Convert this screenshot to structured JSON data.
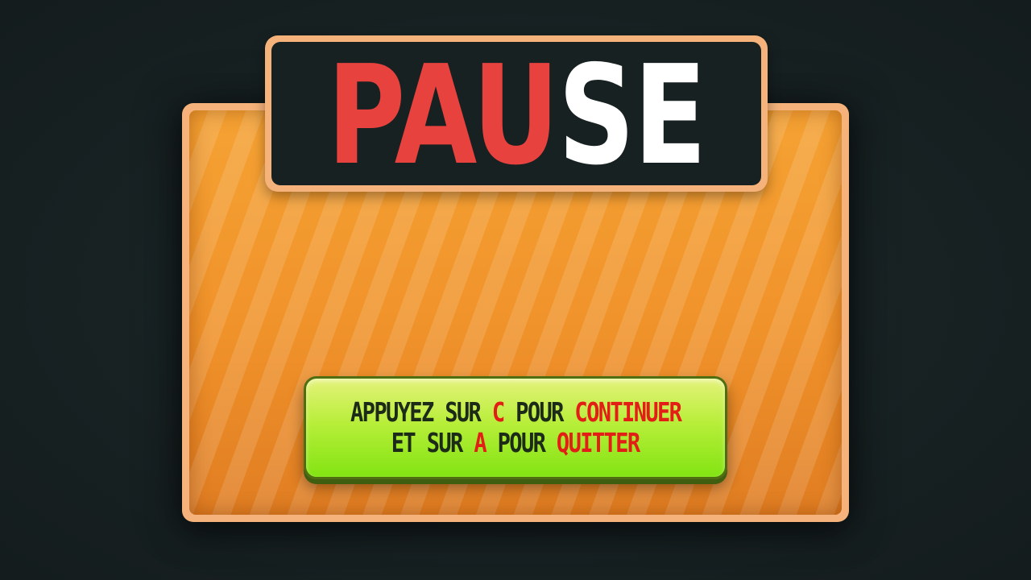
{
  "title": {
    "red_part": "PAU",
    "white_part": "SE"
  },
  "hint": {
    "line1": {
      "before": "APPUYEZ SUR ",
      "key": "C",
      "middle": " POUR ",
      "action": "CONTINUER"
    },
    "line2": {
      "before": "ET SUR ",
      "key": "A",
      "middle": " POUR ",
      "action": "QUITTER"
    }
  },
  "colors": {
    "background": "#182223",
    "panel_border": "#f5b27a",
    "panel_fill": "#f0922a",
    "title_bg": "#182121",
    "title_red": "#e8423f",
    "title_white": "#ffffff",
    "hint_green": "#9eea26",
    "hint_key_red": "#e21e16",
    "hint_text": "#1c2a18"
  }
}
